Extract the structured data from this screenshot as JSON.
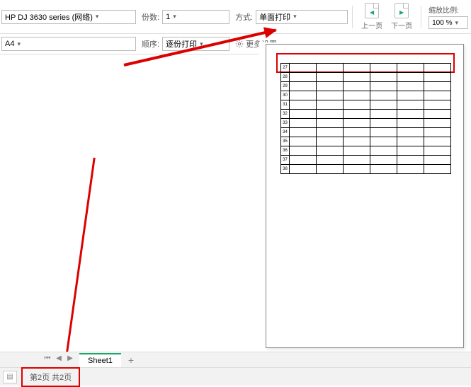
{
  "toolbar": {
    "printer": "HP DJ 3630 series (网络)",
    "paper": "A4",
    "copies_label": "份数:",
    "copies_value": "1",
    "order_label": "顺序:",
    "order_value": "逐份打印",
    "mode_label": "方式:",
    "mode_value": "单面打印",
    "more_settings": "更多设置",
    "prev_page": "上一页",
    "next_page": "下一页",
    "zoom_label": "缩放比例:",
    "zoom_value": "100 %"
  },
  "preview": {
    "row_numbers": [
      "27",
      "28",
      "29",
      "30",
      "31",
      "32",
      "33",
      "34",
      "35",
      "36",
      "37",
      "38"
    ]
  },
  "tabs": {
    "sheet_name": "Sheet1"
  },
  "status": {
    "page_info": "第2页 共2页"
  }
}
